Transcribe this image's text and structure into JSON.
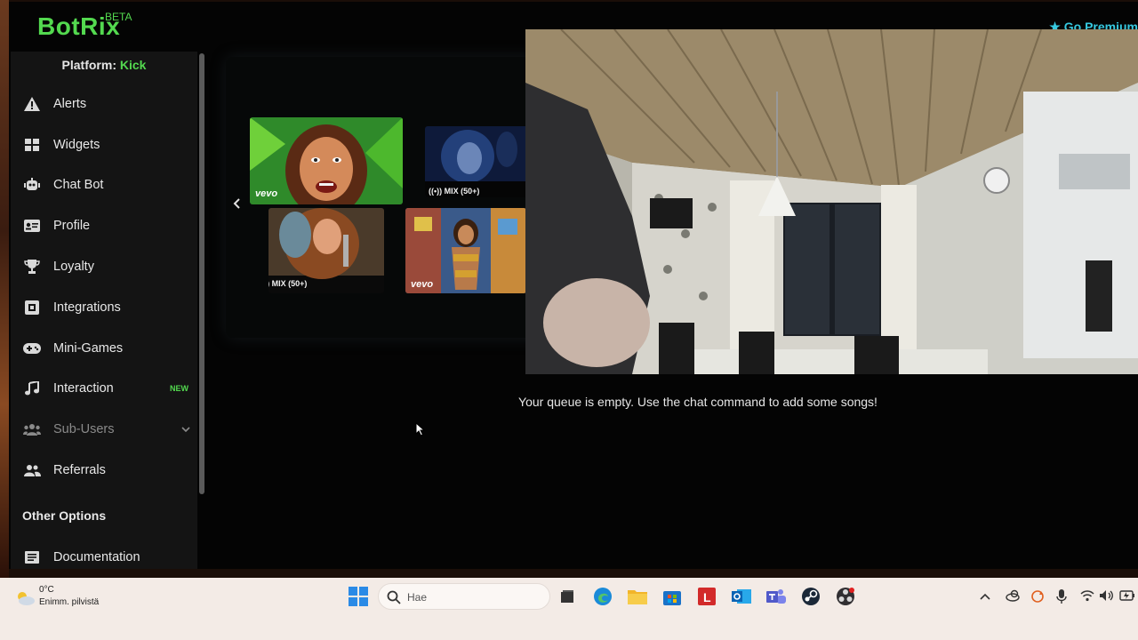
{
  "header": {
    "logo": "BotRix",
    "beta": "BETA",
    "premium": "Go Premium"
  },
  "sidebar": {
    "platform_label": "Platform:",
    "platform_value": "Kick",
    "items": [
      {
        "label": "Alerts",
        "icon": "warning-icon"
      },
      {
        "label": "Widgets",
        "icon": "widgets-grid-icon"
      },
      {
        "label": "Chat Bot",
        "icon": "robot-icon"
      },
      {
        "label": "Profile",
        "icon": "id-card-icon"
      },
      {
        "label": "Loyalty",
        "icon": "trophy-icon"
      },
      {
        "label": "Integrations",
        "icon": "integrations-icon"
      },
      {
        "label": "Mini-Games",
        "icon": "gamepad-icon"
      },
      {
        "label": "Interaction",
        "icon": "music-note-icon",
        "badge": "NEW"
      },
      {
        "label": "Sub-Users",
        "icon": "users-icon"
      },
      {
        "label": "Referrals",
        "icon": "user-group-icon"
      }
    ],
    "other_options_title": "Other Options",
    "documentation": "Documentation"
  },
  "player": {
    "thumbs": [
      {
        "caption": "",
        "brand": "vevo"
      },
      {
        "caption": "MIX (50+)",
        "brand": ""
      },
      {
        "caption": "MIX (50+)",
        "brand": ""
      },
      {
        "caption": "",
        "brand": "vevo"
      }
    ]
  },
  "queue": {
    "empty_message": "Your queue is empty. Use the chat command to add some songs!"
  },
  "taskbar": {
    "weather_temp": "0°C",
    "weather_desc": "Enimm. pilvistä",
    "search_placeholder": "Hae"
  },
  "colors": {
    "accent": "#53d94f",
    "premium": "#36c9e0",
    "sidebar_bg": "#141414"
  }
}
